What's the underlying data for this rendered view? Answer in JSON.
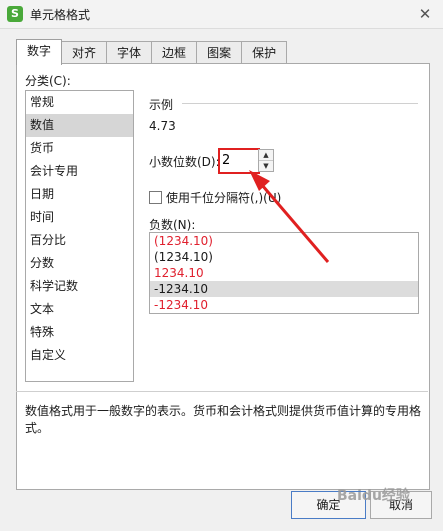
{
  "window": {
    "title": "单元格格式",
    "app_icon": "S"
  },
  "tabs": [
    "数字",
    "对齐",
    "字体",
    "边框",
    "图案",
    "保护"
  ],
  "category": {
    "label": "分类(C):",
    "items": [
      "常规",
      "数值",
      "货币",
      "会计专用",
      "日期",
      "时间",
      "百分比",
      "分数",
      "科学记数",
      "文本",
      "特殊",
      "自定义"
    ]
  },
  "sample": {
    "label": "示例",
    "value": "4.73"
  },
  "decimal": {
    "label": "小数位数(D):",
    "value": "2"
  },
  "thousand": {
    "label": "使用千位分隔符(,)(U)"
  },
  "negative": {
    "label": "负数(N):",
    "items": [
      "(1234.10)",
      "(1234.10)",
      "1234.10",
      "-1234.10",
      "-1234.10"
    ]
  },
  "description": "数值格式用于一般数字的表示。货币和会计格式则提供货币值计算的专用格式。",
  "buttons": {
    "ok": "确定",
    "cancel": "取消"
  },
  "watermark": "Baidu经验",
  "colors": {
    "red": "#e0202e",
    "highlight": "#e02020",
    "selected": "#d6d6d6"
  }
}
